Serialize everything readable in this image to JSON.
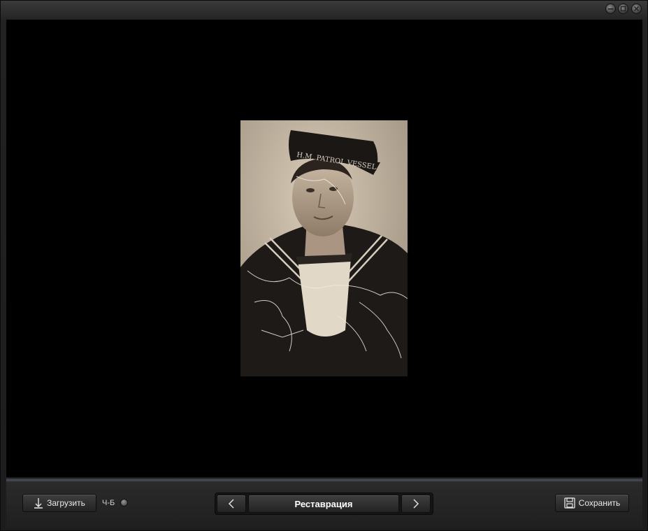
{
  "toolbar": {
    "load_label": "Загрузить",
    "bw_label": "Ч-Б",
    "mode_title": "Реставрация",
    "save_label": "Сохранить"
  },
  "photo": {
    "cap_text": "H.M. PATROL VESSEL"
  },
  "icons": {
    "load": "anchor-download-icon",
    "save": "floppy-disk-icon",
    "prev": "chevron-left-icon",
    "next": "chevron-right-icon",
    "minimize": "minimize-icon",
    "maximize": "maximize-icon",
    "close": "close-icon"
  },
  "colors": {
    "viewport_bg": "#000000",
    "toolbar_bg": "#242424",
    "accent": "#4b5460"
  }
}
